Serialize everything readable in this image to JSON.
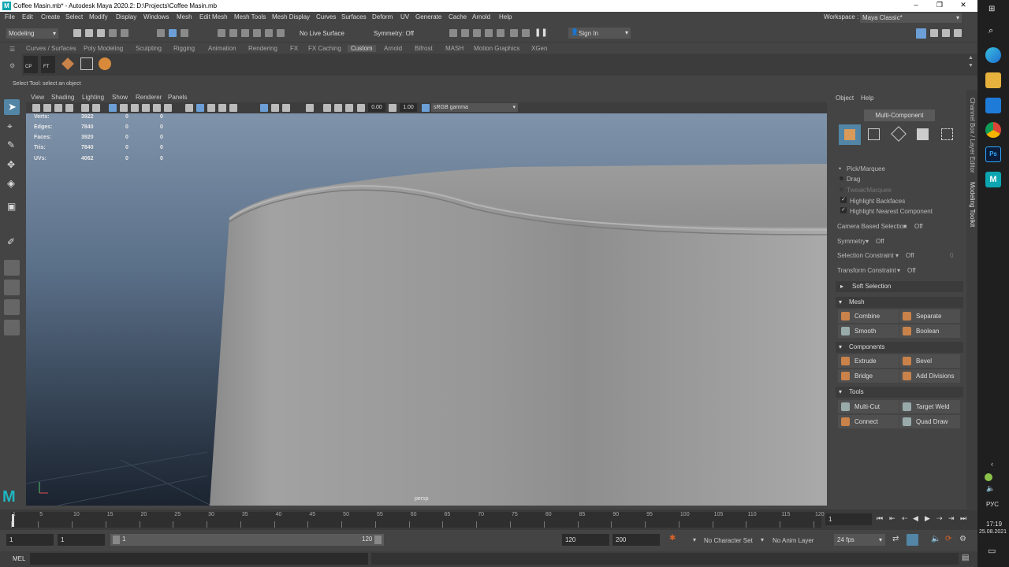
{
  "window": {
    "title": "Coffee Masin.mb* - Autodesk Maya 2020.2: D:\\Projects\\Coffee Masin.mb",
    "logo": "M",
    "controls": [
      "–",
      "❐",
      "✕"
    ]
  },
  "menu": {
    "items": [
      "File",
      "Edit",
      "Create",
      "Select",
      "Modify",
      "Display",
      "Windows",
      "Mesh",
      "Edit Mesh",
      "Mesh Tools",
      "Mesh Display",
      "Curves",
      "Surfaces",
      "Deform",
      "UV",
      "Generate",
      "Cache",
      "Arnold",
      "Help"
    ],
    "workspace_label": "Workspace :",
    "workspace_value": "Maya Classic*"
  },
  "status": {
    "mode": "Modeling",
    "live_surface": "No Live Surface",
    "symmetry": "Symmetry: Off",
    "sign_in": "Sign In"
  },
  "shelf": {
    "tabs": [
      "Curves / Surfaces",
      "Poly Modeling",
      "Sculpting",
      "Rigging",
      "Animation",
      "Rendering",
      "FX",
      "FX Caching",
      "Custom",
      "Arnold",
      "Bifrost",
      "MASH",
      "Motion Graphics",
      "XGen"
    ],
    "active_tab": "Custom",
    "buttons": [
      "CP",
      "FT"
    ]
  },
  "help_line": "Select Tool: select an object",
  "viewport": {
    "menus": [
      "View",
      "Shading",
      "Lighting",
      "Show",
      "Renderer",
      "Panels"
    ],
    "exposure": "0.00",
    "gamma": "1.00",
    "color_space": "sRGB gamma",
    "camera": "persp",
    "hud": [
      {
        "label": "Verts:",
        "values": [
          "3922",
          "0",
          "0"
        ]
      },
      {
        "label": "Edges:",
        "values": [
          "7840",
          "0",
          "0"
        ]
      },
      {
        "label": "Faces:",
        "values": [
          "3920",
          "0",
          "0"
        ]
      },
      {
        "label": "Tris:",
        "values": [
          "7840",
          "0",
          "0"
        ]
      },
      {
        "label": "UVs:",
        "values": [
          "4062",
          "0",
          "0"
        ]
      }
    ]
  },
  "modeling_toolkit": {
    "menus": [
      "Object",
      "Help"
    ],
    "multi_component": "Multi-Component",
    "pick_marquee": "Pick/Marquee",
    "drag": "Drag",
    "tweak_marquee": "Tweak/Marquee",
    "highlight_backfaces": "Highlight Backfaces",
    "highlight_nearest": "Highlight Nearest Component",
    "camera_based": {
      "label": "Camera Based Selection",
      "value": "Off"
    },
    "symmetry": {
      "label": "Symmetry",
      "value": "Off"
    },
    "selection_constraint": {
      "label": "Selection Constraint",
      "value": "Off",
      "extra": "0"
    },
    "transform_constraint": {
      "label": "Transform Constraint",
      "value": "Off"
    },
    "soft_selection": "Soft Selection",
    "sections": {
      "mesh": "Mesh",
      "components": "Components",
      "tools": "Tools"
    },
    "mesh_buttons": [
      "Combine",
      "Separate",
      "Smooth",
      "Boolean"
    ],
    "component_buttons": [
      "Extrude",
      "Bevel",
      "Bridge",
      "Add Divisions"
    ],
    "tool_buttons": [
      "Multi-Cut",
      "Target Weld",
      "Connect",
      "Quad Draw"
    ],
    "side_tabs": [
      "Channel Box / Layer Editor",
      "Modeling Toolkit"
    ]
  },
  "timeline": {
    "ticks": [
      "1",
      "5",
      "10",
      "15",
      "20",
      "25",
      "30",
      "35",
      "40",
      "45",
      "50",
      "55",
      "60",
      "65",
      "70",
      "75",
      "80",
      "85",
      "90",
      "95",
      "100",
      "105",
      "110",
      "115",
      "120"
    ],
    "current_frame": "1"
  },
  "range": {
    "start": "1",
    "playback_start": "1",
    "slider_start": "1",
    "slider_end": "120",
    "playback_end": "120",
    "end": "200",
    "character_set": "No Character Set",
    "anim_layer": "No Anim Layer",
    "fps": "24 fps"
  },
  "command_line": {
    "label": "MEL"
  },
  "taskbar": {
    "lang": "РУС",
    "time": "17:19",
    "date": "25.08.2021"
  }
}
